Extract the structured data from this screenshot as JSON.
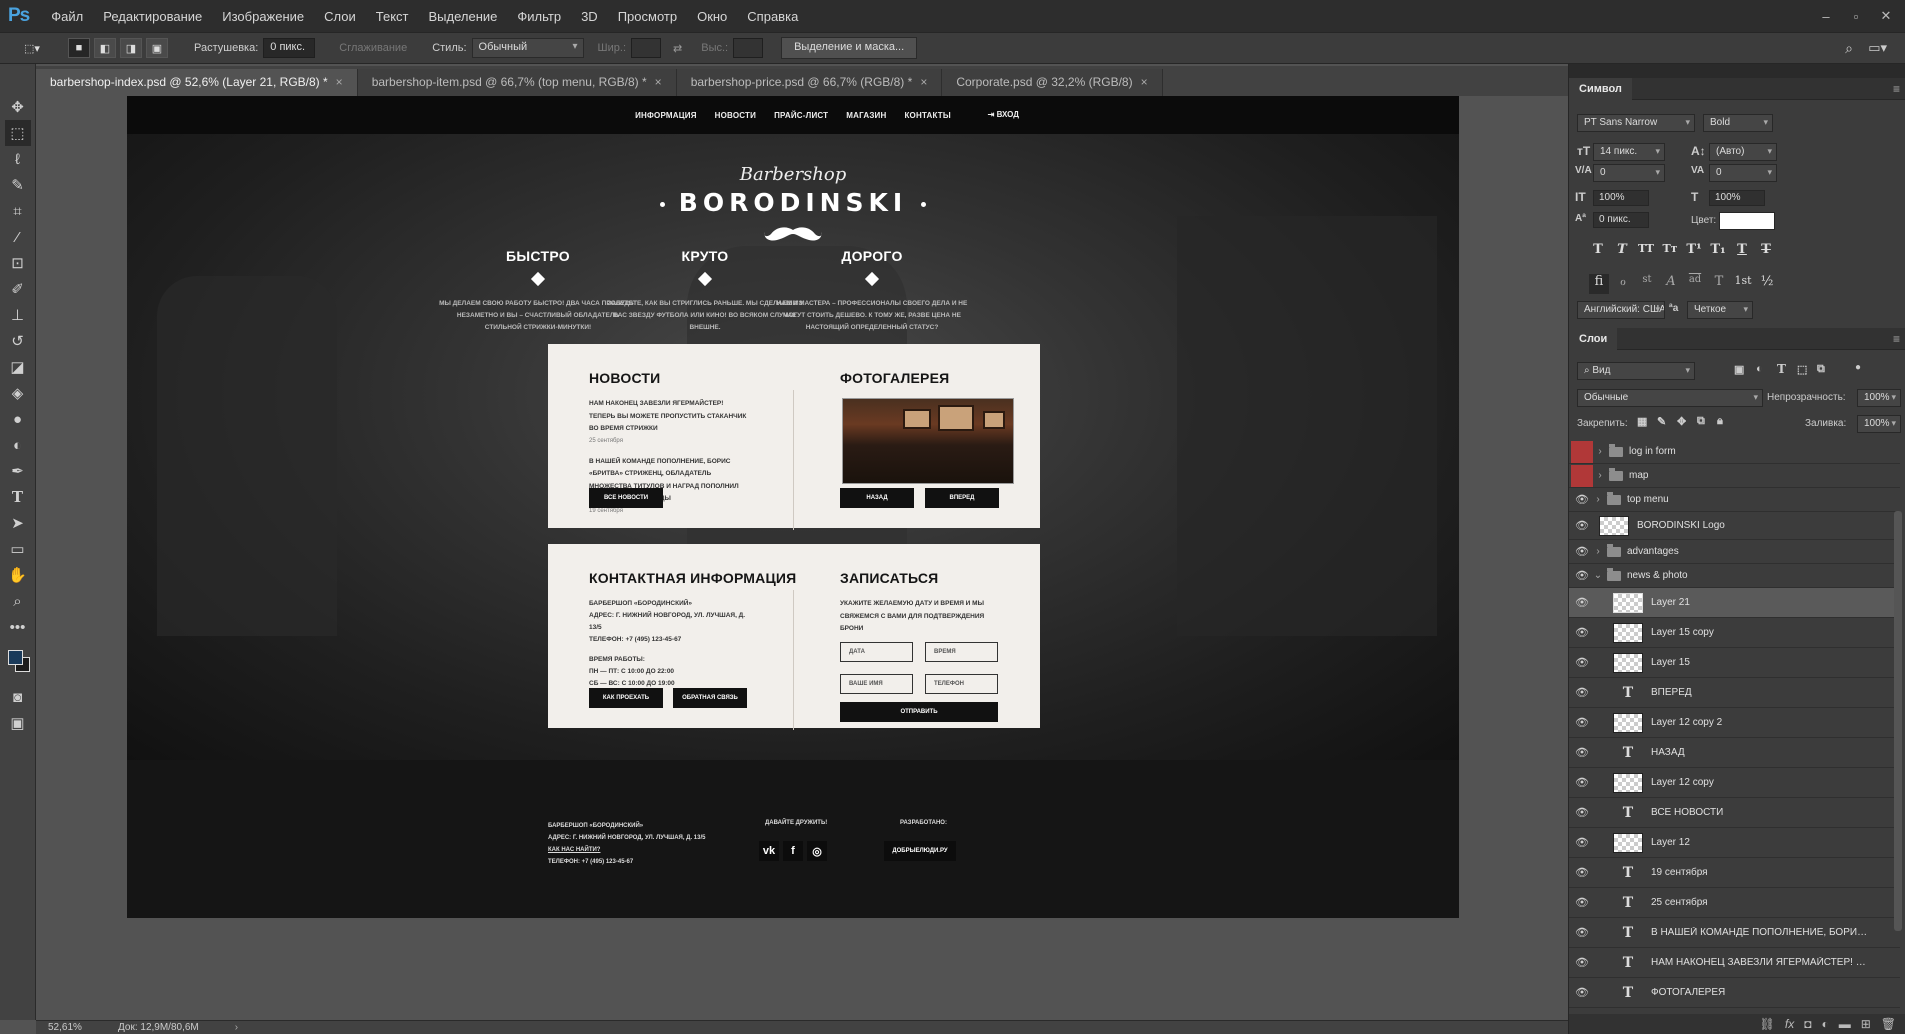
{
  "app": {
    "logo": "Ps",
    "menu": [
      "Файл",
      "Редактирование",
      "Изображение",
      "Слои",
      "Текст",
      "Выделение",
      "Фильтр",
      "3D",
      "Просмотр",
      "Окно",
      "Справка"
    ],
    "window_controls": [
      "–",
      "▫",
      "✕"
    ]
  },
  "options": {
    "feather_label": "Растушевка:",
    "feather_value": "0 пикс.",
    "antialias_label": "Сглаживание",
    "style_label": "Стиль:",
    "style_value": "Обычный",
    "width_label": "Шир.:",
    "height_label": "Выс.:",
    "mask_button": "Выделение и маска..."
  },
  "tabs": [
    {
      "label": "barbershop-index.psd @ 52,6% (Layer 21, RGB/8) *",
      "close": "×"
    },
    {
      "label": "barbershop-item.psd @ 66,7% (top menu, RGB/8) *",
      "close": "×"
    },
    {
      "label": "barbershop-price.psd @ 66,7% (RGB/8) *",
      "close": "×"
    },
    {
      "label": "Corporate.psd @ 32,2% (RGB/8)",
      "close": "×"
    }
  ],
  "site": {
    "nav": [
      "ИНФОРМАЦИЯ",
      "НОВОСТИ",
      "ПРАЙС-ЛИСТ",
      "МАГАЗИН",
      "КОНТАКТЫ"
    ],
    "login": "ВХОД",
    "logo_script": "Barbershop",
    "logo_main": "BORODINSKI",
    "advantages": [
      {
        "title": "БЫСТРО",
        "text": "МЫ ДЕЛАЕМ СВОЮ РАБОТУ БЫСТРО! ДВА ЧАСА ПРОЛЕТЯТ НЕЗАМЕТНО И ВЫ – СЧАСТЛИВЫЙ ОБЛАДАТЕЛЬ СТИЛЬНОЙ СТРИЖКИ-МИНУТКИ!"
      },
      {
        "title": "КРУТО",
        "text": "ЗАБУДЬТЕ, КАК ВЫ СТРИГЛИСЬ РАНЬШЕ. МЫ СДЕЛАЕМ ИЗ ВАС ЗВЕЗДУ ФУТБОЛА ИЛИ КИНО! ВО ВСЯКОМ СЛУЧАЕ ВНЕШНЕ."
      },
      {
        "title": "ДОРОГО",
        "text": "НАШИ МАСТЕРА – ПРОФЕССИОНАЛЫ СВОЕГО ДЕЛА И НЕ МОГУТ СТОИТЬ ДЕШЕВО. К ТОМУ ЖЕ, РАЗВЕ ЦЕНА НЕ НАСТОЯЩИЙ ОПРЕДЕЛЕННЫЙ СТАТУС?"
      }
    ],
    "news": {
      "title": "НОВОСТИ",
      "item1": "НАМ НАКОНЕЦ ЗАВЕЗЛИ ЯГЕРМАЙСТЕР! ТЕПЕРЬ ВЫ МОЖЕТЕ ПРОПУСТИТЬ СТАКАНЧИК ВО ВРЕМЯ СТРИЖКИ",
      "date1": "25 сентября",
      "item2": "В НАШЕЙ КОМАНДЕ ПОПОЛНЕНИЕ, БОРИС «БРИТВА» СТРИЖЕНЦ, ОБЛАДАТЕЛЬ МНОЖЕСТВА ТИТУЛОВ И НАГРАД ПОПОЛНИЛ НАШИ СТРОЙНЫЕ РЯДЫ",
      "date2": "19 сентября",
      "button": "ВСЕ НОВОСТИ"
    },
    "gallery": {
      "title": "ФОТОГАЛЕРЕЯ",
      "prev": "НАЗАД",
      "next": "ВПЕРЕД"
    },
    "contacts": {
      "title": "КОНТАКТНАЯ ИНФОРМАЦИЯ",
      "line1": "БАРБЕРШОП «БОРОДИНСКИЙ»",
      "line2": "АДРЕС: Г. НИЖНИЙ НОВГОРОД, УЛ. ЛУЧШАЯ, Д. 13/5",
      "line3": "ТЕЛЕФОН: +7 (495) 123-45-67",
      "hours_title": "ВРЕМЯ РАБОТЫ:",
      "hours1": "ПН — ПТ: С 10:00 ДО 22:00",
      "hours2": "СБ — ВС: С 10:00 ДО 19:00",
      "btn_route": "КАК ПРОЕХАТЬ",
      "btn_feedback": "ОБРАТНАЯ СВЯЗЬ"
    },
    "booking": {
      "title": "ЗАПИСАТЬСЯ",
      "text": "УКАЖИТЕ ЖЕЛАЕМУЮ ДАТУ И ВРЕМЯ И МЫ СВЯЖЕМСЯ С ВАМИ ДЛЯ ПОДТВЕРЖДЕНИЯ БРОНИ",
      "date": "ДАТА",
      "time": "ВРЕМЯ",
      "name": "ВАШЕ ИМЯ",
      "phone": "ТЕЛЕФОН",
      "submit": "ОТПРАВИТЬ"
    },
    "footer": {
      "line1": "БАРБЕРШОП «БОРОДИНСКИЙ»",
      "line2": "АДРЕС: Г. НИЖНИЙ НОВГОРОД, УЛ. ЛУЧШАЯ, Д. 13/5",
      "line3": "КАК НАС НАЙТИ?",
      "line4": "ТЕЛЕФОН: +7 (495) 123-45-67",
      "friends": "ДАВАЙТЕ ДРУЖИТЬ!",
      "social": [
        "vk",
        "f",
        "◎"
      ],
      "dev_label": "РАЗРАБОТАНО:",
      "dev_button": "ДОБРЫЕЛЮДИ.РУ"
    }
  },
  "status": {
    "zoom": "52,61%",
    "doc": "Док: 12,9M/80,6M",
    "arrow": "›"
  },
  "character_panel": {
    "tab": "Символ",
    "font_family": "PT Sans Narrow",
    "font_style": "Bold",
    "size": "14 пикс.",
    "leading": "(Авто)",
    "kerning": "0",
    "tracking": "0",
    "vscale": "100%",
    "hscale": "100%",
    "baseline": "0 пикс.",
    "color_label": "Цвет:",
    "language": "Английский: США",
    "antialias": "Четкое",
    "format_buttons": [
      "T",
      "T",
      "TT",
      "Tт",
      "T¹",
      "T₁",
      "T",
      "T"
    ],
    "opentype_buttons": [
      "fi",
      "ℴ",
      "st",
      "A",
      "ad",
      "T",
      "1st",
      "½"
    ]
  },
  "layers_panel": {
    "tab": "Слои",
    "filter": "Вид",
    "blend": "Обычные",
    "opacity_label": "Непрозрачность:",
    "opacity": "100%",
    "lock_label": "Закрепить:",
    "fill_label": "Заливка:",
    "fill": "100%",
    "layers": [
      {
        "name": "log in form",
        "type": "folder",
        "hidden": true
      },
      {
        "name": "map",
        "type": "folder",
        "hidden": true
      },
      {
        "name": "top menu",
        "type": "folder",
        "hidden": false
      },
      {
        "name": "BORODINSKI Logo",
        "type": "image",
        "hidden": false
      },
      {
        "name": "advantages",
        "type": "folder",
        "hidden": false
      },
      {
        "name": "news & photo",
        "type": "folder-open",
        "hidden": false
      },
      {
        "name": "Layer 21",
        "type": "image",
        "hidden": false,
        "selected": true
      },
      {
        "name": "Layer 15 copy",
        "type": "image",
        "hidden": false
      },
      {
        "name": "Layer 15",
        "type": "image",
        "hidden": false
      },
      {
        "name": "ВПЕРЕД",
        "type": "text",
        "hidden": false
      },
      {
        "name": "Layer 12 copy 2",
        "type": "image",
        "hidden": false
      },
      {
        "name": "НАЗАД",
        "type": "text",
        "hidden": false
      },
      {
        "name": "Layer 12 copy",
        "type": "image",
        "hidden": false
      },
      {
        "name": "ВСЕ НОВОСТИ",
        "type": "text",
        "hidden": false
      },
      {
        "name": "Layer 12",
        "type": "image",
        "hidden": false
      },
      {
        "name": "19 сентября",
        "type": "text",
        "hidden": false
      },
      {
        "name": "25 сентября",
        "type": "text",
        "hidden": false
      },
      {
        "name": "В НАШЕЙ КОМАНДЕ ПОПОЛНЕНИЕ, БОРИС ...",
        "type": "text",
        "hidden": false
      },
      {
        "name": "НАМ НАКОНЕЦ ЗАВЕЗЛИ ЯГЕРМАЙСТЕР! ТЕ...",
        "type": "text",
        "hidden": false
      },
      {
        "name": "ФОТОГАЛЕРЕЯ",
        "type": "text",
        "hidden": false
      }
    ]
  }
}
